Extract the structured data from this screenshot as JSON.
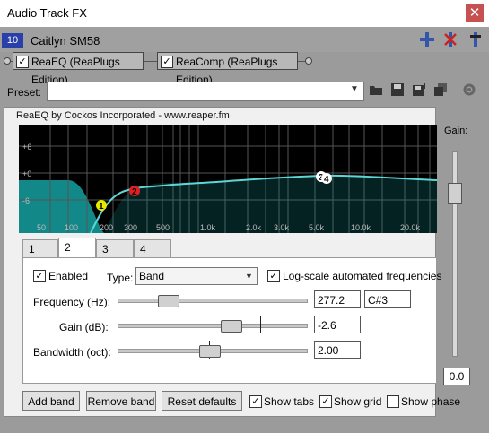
{
  "window": {
    "title": "Audio Track FX",
    "close": "✕"
  },
  "track": {
    "number": "10",
    "name": "Caitlyn SM58"
  },
  "chain": {
    "fx": [
      {
        "label": "ReaEQ (ReaPlugs Edition)",
        "checked": true
      },
      {
        "label": "ReaComp (ReaPlugs Edition)",
        "checked": true
      }
    ]
  },
  "preset": {
    "label": "Preset:",
    "value": ""
  },
  "eq": {
    "title": "ReaEQ by Cockos Incorporated - www.reaper.fm",
    "db_labels": [
      "+6",
      "+0",
      "-6"
    ],
    "freq_labels": [
      "50",
      "100",
      "200",
      "300",
      "500",
      "1.0k",
      "2.0k",
      "3.0k",
      "5.0k",
      "10.0k",
      "20.0k"
    ],
    "band_markers": [
      "1",
      "2",
      "3",
      "4"
    ]
  },
  "gain": {
    "label": "Gain:",
    "value": "0.0",
    "level_db": 0.0
  },
  "tabs": [
    "1",
    "2",
    "3",
    "4"
  ],
  "band": {
    "enabled_label": "Enabled",
    "enabled": true,
    "type_label": "Type:",
    "type_value": "Band",
    "logscale_label": "Log-scale automated frequencies",
    "logscale": true,
    "frequency_label": "Frequency (Hz):",
    "frequency_value": "277.2",
    "note_value": "C#3",
    "gain_label": "Gain (dB):",
    "gain_value": "-2.6",
    "bandwidth_label": "Bandwidth (oct):",
    "bandwidth_value": "2.00"
  },
  "buttons": {
    "add": "Add band",
    "remove": "Remove band",
    "reset": "Reset defaults"
  },
  "options": {
    "show_tabs": {
      "label": "Show tabs",
      "checked": true
    },
    "show_grid": {
      "label": "Show grid",
      "checked": true
    },
    "show_phase": {
      "label": "Show phase",
      "checked": false
    }
  },
  "colors": {
    "curve": "#5fd6d6",
    "fill": "#128888",
    "band1": "#e8e800",
    "band2": "#e02020",
    "band34": "#ffffff",
    "track_badge": "#2a3fa8"
  }
}
